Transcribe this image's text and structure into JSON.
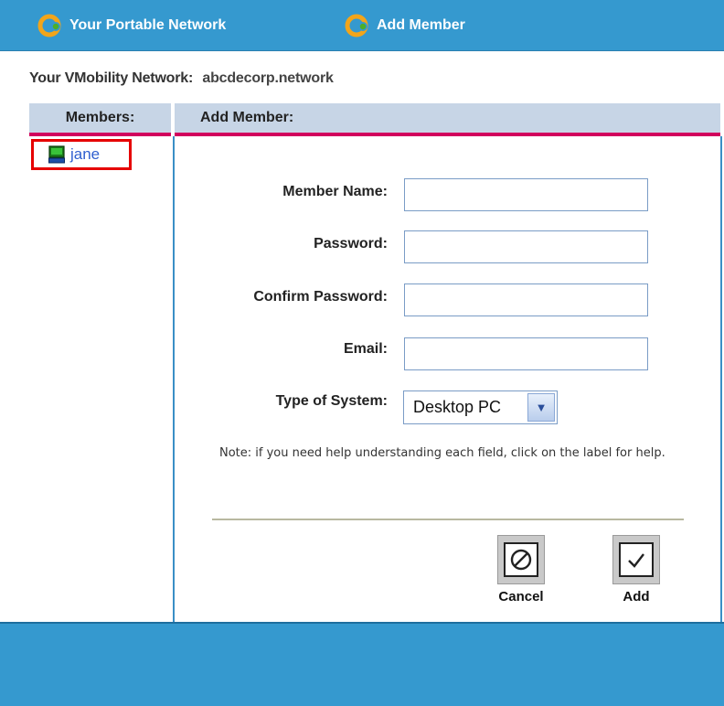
{
  "topnav": {
    "portable_network": "Your Portable Network",
    "add_member": "Add Member"
  },
  "network": {
    "label": "Your VMobility Network:",
    "value": "abcdecorp.network"
  },
  "members_panel": {
    "header": "Members:",
    "items": [
      {
        "name": "jane",
        "icon": "desktop-pc-icon",
        "highlighted": true
      }
    ]
  },
  "add_panel": {
    "header": "Add Member:",
    "fields": {
      "member_name": {
        "label": "Member Name:",
        "value": ""
      },
      "password": {
        "label": "Password:",
        "value": ""
      },
      "confirm_password": {
        "label": "Confirm Password:",
        "value": ""
      },
      "email": {
        "label": "Email:",
        "value": ""
      },
      "system_type": {
        "label": "Type of System:",
        "selected": "Desktop PC"
      }
    },
    "note": "Note: if you need help understanding each field, click on the label for help.",
    "buttons": {
      "cancel": "Cancel",
      "add": "Add"
    }
  },
  "colors": {
    "bar_blue": "#3599cf",
    "header_bg": "#c7d5e6",
    "header_underline": "#d1005d",
    "highlight_red": "#e60000",
    "link_blue": "#2f5fcf"
  }
}
